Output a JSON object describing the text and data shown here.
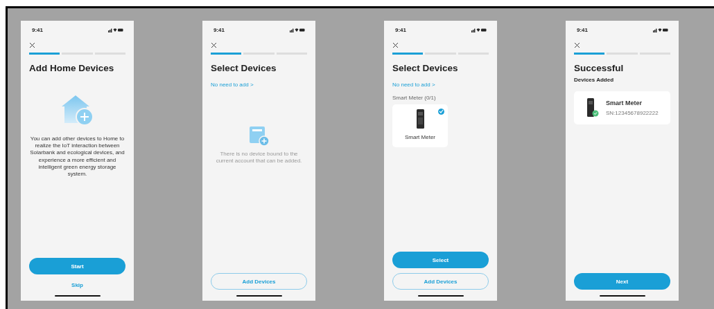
{
  "screens": [
    {
      "time": "9:41",
      "steps": [
        {
          "active": true
        },
        {
          "active": false
        },
        {
          "active": false
        }
      ],
      "title": "Add Home Devices",
      "blocks": [
        {
          "kind": "intro",
          "text": "You can add other devices to Home to realize the IoT interaction between Solarbank and ecological devices, and experience a more efficient and intelligent green energy storage system."
        }
      ],
      "buttons": [
        {
          "kind": "primary",
          "label": "Start"
        },
        {
          "kind": "text",
          "label": "Skip"
        }
      ]
    },
    {
      "time": "9:41",
      "steps": [
        {
          "active": true
        },
        {
          "active": false
        },
        {
          "active": false
        }
      ],
      "title": "Select Devices",
      "blocks": [
        {
          "kind": "link",
          "text": "No need to add >"
        },
        {
          "kind": "empty",
          "text": "There is no device bound to the current account that can be added."
        }
      ],
      "buttons": [
        {
          "kind": "outline",
          "label": "Add Devices"
        }
      ]
    },
    {
      "time": "9:41",
      "steps": [
        {
          "active": true
        },
        {
          "active": false
        },
        {
          "active": false
        }
      ],
      "title": "Select Devices",
      "blocks": [
        {
          "kind": "link",
          "text": "No need to add >"
        },
        {
          "kind": "section",
          "text": "Smart Meter (0/1)"
        },
        {
          "kind": "grid",
          "devices": [
            {
              "name": "Smart Meter",
              "selected": true
            }
          ]
        }
      ],
      "buttons": [
        {
          "kind": "primary",
          "label": "Select"
        },
        {
          "kind": "outline",
          "label": "Add Devices"
        }
      ]
    },
    {
      "time": "9:41",
      "steps": [
        {
          "active": true
        },
        {
          "active": false
        },
        {
          "active": false
        }
      ],
      "title": "Successful",
      "blocks": [
        {
          "kind": "subtitle",
          "text": "Devices Added"
        },
        {
          "kind": "added",
          "devices": [
            {
              "name": "Smart Meter",
              "serial": "SN:12345678922222"
            }
          ]
        }
      ],
      "buttons": [
        {
          "kind": "primary",
          "label": "Next"
        }
      ]
    }
  ]
}
